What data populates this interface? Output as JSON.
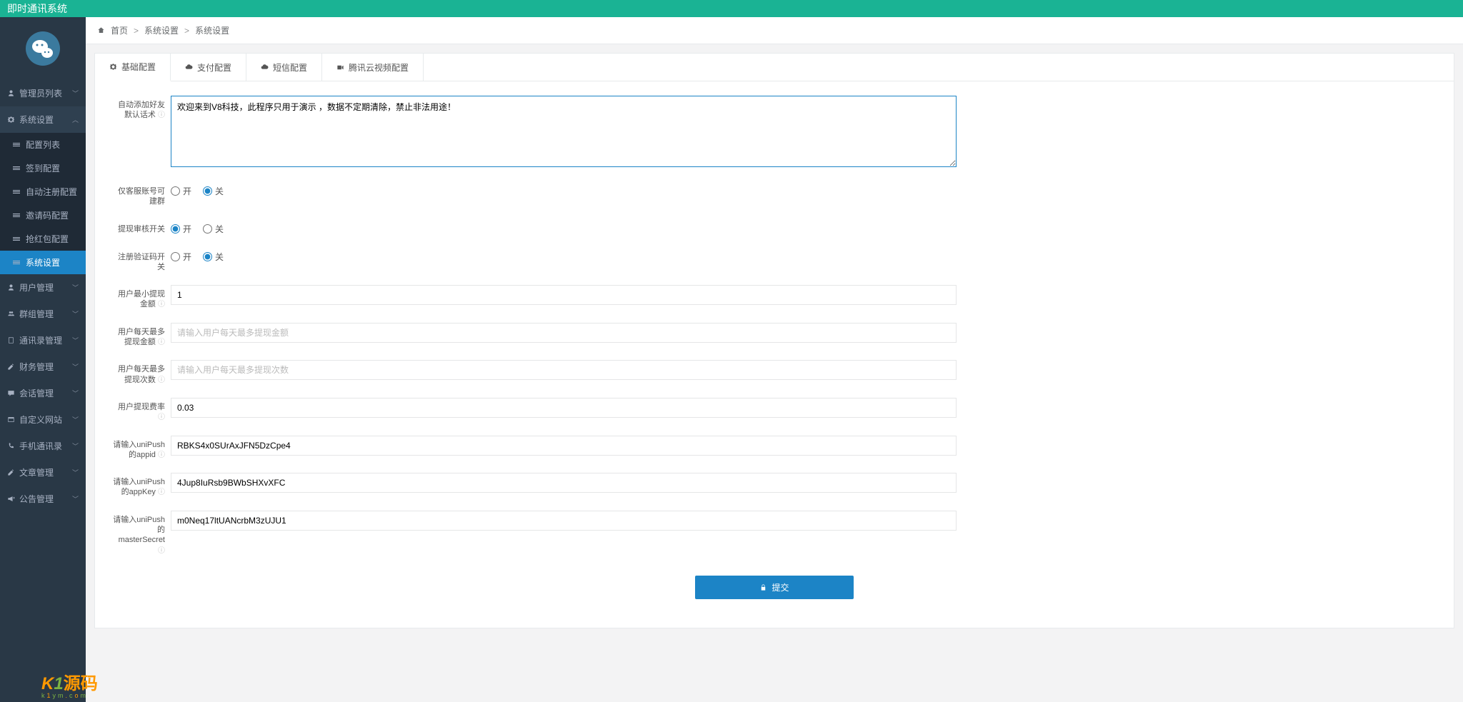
{
  "header": {
    "title": "即时通讯系统"
  },
  "breadcrumb": {
    "home": "首页",
    "l1": "系统设置",
    "l2": "系统设置"
  },
  "sidebar": {
    "admin_list": "管理员列表",
    "system_settings": "系统设置",
    "sub": {
      "config_list": "配置列表",
      "signin_config": "签到配置",
      "auto_register": "自动注册配置",
      "invite_code": "邀请码配置",
      "red_packet": "抢红包配置",
      "system_settings": "系统设置"
    },
    "user_mgmt": "用户管理",
    "group_mgmt": "群组管理",
    "contacts_mgmt": "通讯录管理",
    "finance_mgmt": "财务管理",
    "session_mgmt": "会话管理",
    "custom_site": "自定义网站",
    "phone_contacts": "手机通讯录",
    "article_mgmt": "文章管理",
    "notice_mgmt": "公告管理"
  },
  "tabs": {
    "basic": "基础配置",
    "pay": "支付配置",
    "sms": "短信配置",
    "tencent": "腾讯云视频配置"
  },
  "form": {
    "auto_add_friend_label": "自动添加好友默认话术",
    "auto_add_friend_value": "欢迎来到V8科技，此程序只用于演示 ，数据不定期清除，禁止非法用途！",
    "only_cs_label": "仅客服账号可建群",
    "withdraw_audit_label": "提现审核开关",
    "register_captcha_label": "注册验证码开关",
    "min_withdraw_label": "用户最小提现金额",
    "min_withdraw_value": "1",
    "daily_max_amount_label": "用户每天最多提现金额",
    "daily_max_amount_placeholder": "请输入用户每天最多提现金额",
    "daily_max_count_label": "用户每天最多提现次数",
    "daily_max_count_placeholder": "请输入用户每天最多提现次数",
    "withdraw_rate_label": "用户提现费率",
    "withdraw_rate_value": "0.03",
    "unipush_appid_label": "请输入uniPush的appid",
    "unipush_appid_value": "RBKS4x0SUrAxJFN5DzCpe4",
    "unipush_appkey_label": "请输入uniPush的appKey",
    "unipush_appkey_value": "4Jup8IuRsb9BWbSHXvXFC",
    "unipush_secret_label": "请输入uniPush的masterSecret",
    "unipush_secret_value": "m0Neq17ltUANcrbM3zUJU1",
    "on": "开",
    "off": "关",
    "submit": "提交"
  },
  "watermark": {
    "brand": "K1源码",
    "domain": "k1ym.com"
  }
}
